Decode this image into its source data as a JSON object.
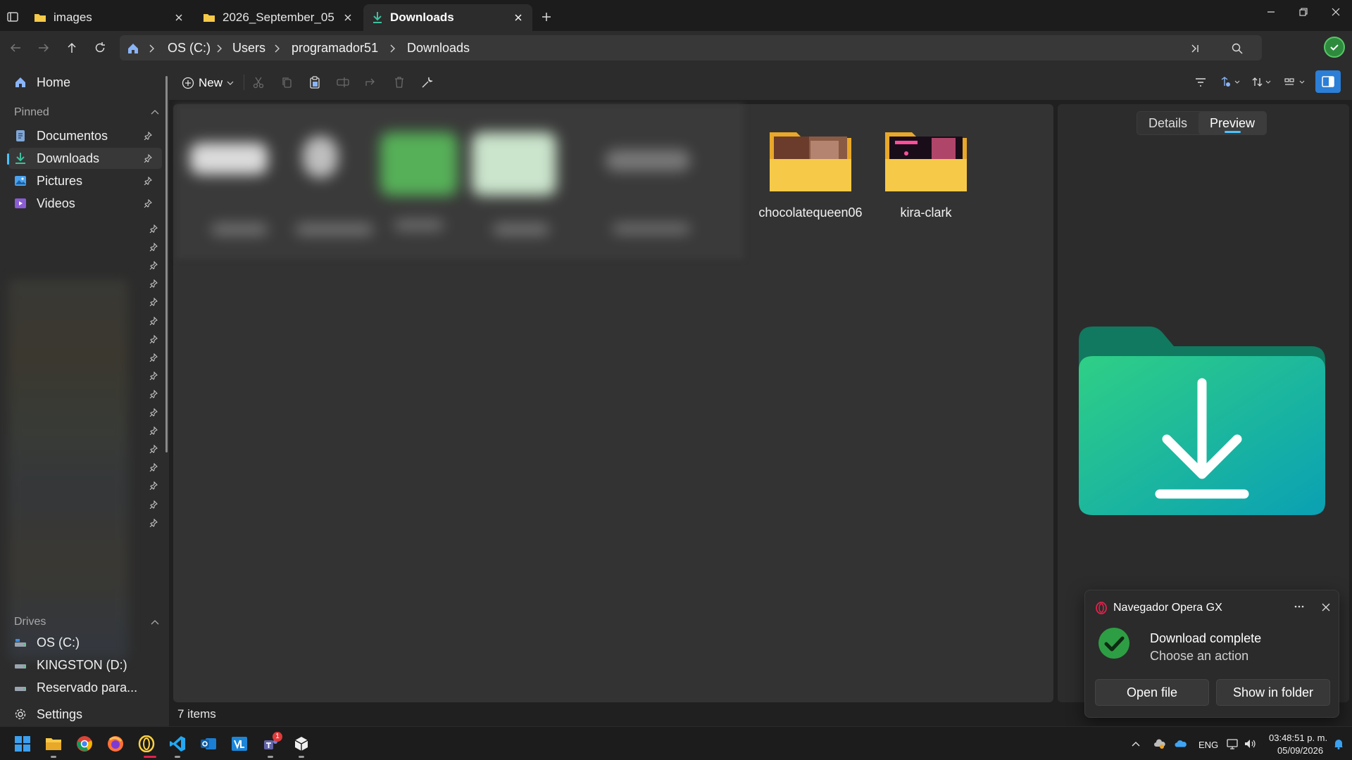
{
  "tabs": [
    {
      "label": "images",
      "icon": "folder-icon",
      "active": false
    },
    {
      "label": "2026_September_05",
      "icon": "folder-icon",
      "active": false
    },
    {
      "label": "Downloads",
      "icon": "download-icon",
      "active": true
    }
  ],
  "breadcrumb": [
    "OS (C:)",
    "Users",
    "programador51",
    "Downloads"
  ],
  "toolbar": {
    "new_label": "New"
  },
  "sidebar": {
    "home_label": "Home",
    "pinned_header": "Pinned",
    "pinned_items": [
      {
        "label": "Documentos",
        "icon": "documents-icon"
      },
      {
        "label": "Downloads",
        "icon": "download-icon",
        "selected": true
      },
      {
        "label": "Pictures",
        "icon": "pictures-icon"
      },
      {
        "label": "Videos",
        "icon": "videos-icon"
      }
    ],
    "drives_header": "Drives",
    "drives": [
      {
        "label": "OS (C:)",
        "icon": "drive-icon"
      },
      {
        "label": "KINGSTON (D:)",
        "icon": "drive-icon"
      },
      {
        "label": "Reservado para...",
        "icon": "drive-icon"
      }
    ],
    "settings_label": "Settings"
  },
  "content": {
    "folders": [
      {
        "name": "chocolatequeen06"
      },
      {
        "name": "kira-clark"
      }
    ],
    "status": "7 items"
  },
  "preview_pane": {
    "tabs": [
      {
        "label": "Details",
        "active": false
      },
      {
        "label": "Preview",
        "active": true
      }
    ]
  },
  "notification": {
    "app": "Navegador Opera GX",
    "title": "Download complete",
    "subtitle": "Choose an action",
    "buttons": [
      "Open file",
      "Show in folder"
    ]
  },
  "tray": {
    "language": "ENG",
    "time": "03:48:51 p. m.",
    "date": "05/09/2026",
    "badge_count": "1"
  },
  "colors": {
    "accent": "#4cc2ff",
    "folder_yellow": "#f7c948",
    "download_folder_teal": "#1fb89a",
    "success_green": "#2e9e44"
  }
}
